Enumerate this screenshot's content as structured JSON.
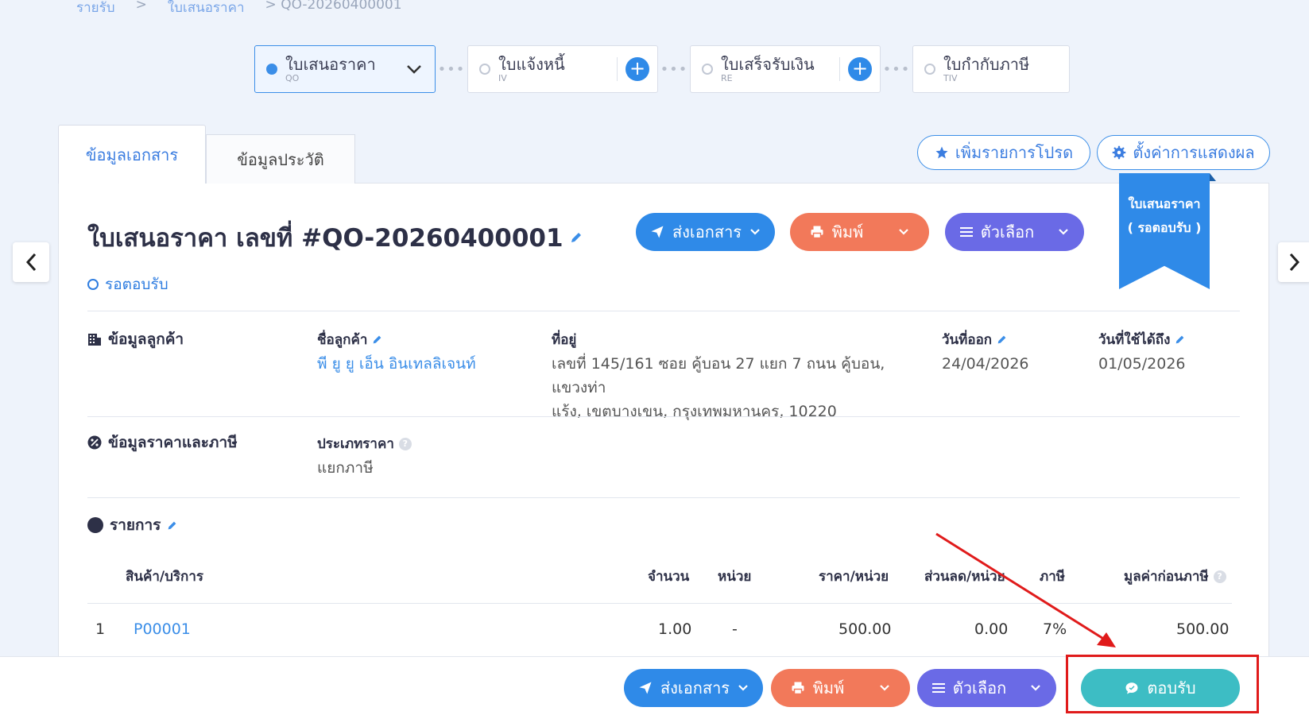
{
  "breadcrumb": {
    "root": "รายรับ",
    "level2": "ใบเสนอราคา",
    "current": "QO-20260400001",
    "sep": ">"
  },
  "steps": [
    {
      "label": "ใบเสนอราคา",
      "code": "QO"
    },
    {
      "label": "ใบแจ้งหนี้",
      "code": "IV"
    },
    {
      "label": "ใบเสร็จรับเงิน",
      "code": "RE"
    },
    {
      "label": "ใบกำกับภาษี",
      "code": "TIV"
    }
  ],
  "tabs": {
    "info": "ข้อมูลเอกสาร",
    "history": "ข้อมูลประวัติ"
  },
  "top_actions": {
    "favorite": "เพิ่มรายการโปรด",
    "display_settings": "ตั้งค่าการแสดงผล"
  },
  "doc": {
    "title": "ใบเสนอราคา เลขที่ #QO-20260400001",
    "status": "รอตอบรับ"
  },
  "ribbon": {
    "line1": "ใบเสนอราคา",
    "line2": "( รอตอบรับ )"
  },
  "actions": {
    "send": "ส่งเอกสาร",
    "print": "พิมพ์",
    "options": "ตัวเลือก",
    "accept": "ตอบรับ"
  },
  "customer": {
    "section": "ข้อมูลลูกค้า",
    "name_label": "ชื่อลูกค้า",
    "name": "พี ยู ยู เอ็น อินเทลลิเจนท์",
    "address_label": "ที่อยู่",
    "address_line1": "เลขที่ 145/161 ซอย คู้บอน 27 แยก 7 ถนน คู้บอน, แขวงท่า",
    "address_line2": "แร้ง, เขตบางเขน, กรุงเทพมหานคร, 10220",
    "issue_label": "วันที่ออก",
    "issue_date": "24/04/2026",
    "valid_label": "วันที่ใช้ได้ถึง",
    "valid_date": "01/05/2026"
  },
  "pricing": {
    "section": "ข้อมูลราคาและภาษี",
    "type_label": "ประเภทราคา",
    "type_value": "แยกภาษี"
  },
  "items": {
    "section": "รายการ",
    "headers": {
      "product": "สินค้า/บริการ",
      "qty": "จำนวน",
      "unit": "หน่วย",
      "price": "ราคา/หน่วย",
      "discount": "ส่วนลด/หน่วย",
      "tax": "ภาษี",
      "pretax": "มูลค่าก่อนภาษี"
    },
    "rows": [
      {
        "no": "1",
        "product": "P00001",
        "qty": "1.00",
        "unit": "-",
        "price": "500.00",
        "discount": "0.00",
        "tax": "7%",
        "pretax": "500.00"
      }
    ]
  },
  "icons": {
    "q": "?",
    "plus": "+",
    "dots": "•••",
    "chev_down": "⌄",
    "chev_left": "‹",
    "chev_right": "›",
    "edit": "✎"
  }
}
